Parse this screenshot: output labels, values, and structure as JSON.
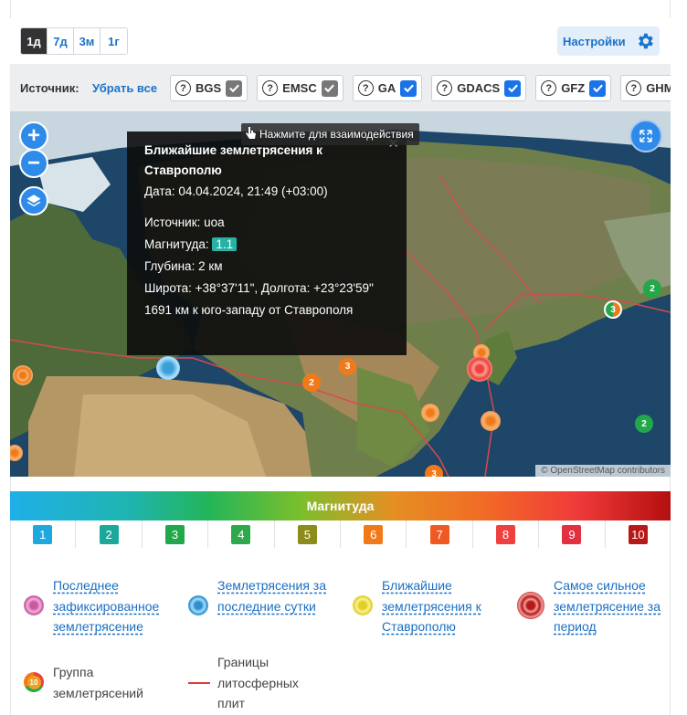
{
  "periods": [
    "1д",
    "7д",
    "3м",
    "1г"
  ],
  "settings_label": "Настройки",
  "source": {
    "label": "Источник:",
    "clear_all": "Убрать все",
    "chips": [
      {
        "name": "BGS",
        "checked": true,
        "color": "grey"
      },
      {
        "name": "EMSC",
        "checked": true,
        "color": "grey"
      },
      {
        "name": "GA",
        "checked": true,
        "color": "blue"
      },
      {
        "name": "GDACS",
        "checked": true,
        "color": "blue"
      },
      {
        "name": "GFZ",
        "checked": true,
        "color": "blue"
      },
      {
        "name": "GHM",
        "checked": false,
        "color": "grey"
      }
    ]
  },
  "map": {
    "hint": "Нажмите для взаимодействия",
    "attribution": "© OpenStreetMap contributors",
    "popup": {
      "title": "Ближайшие землетрясения к Ставрополю",
      "date": "Дата: 04.04.2024, 21:49 (+03:00)",
      "source": "Источник: uoa",
      "mag_label": "Магнитуда:",
      "mag_value": "1.1",
      "depth": "Глубина: 2 км",
      "coords": "Широта: +38°37'11\", Долгота: +23°23'59\"",
      "distance": "1691 км к юго-западу от Ставрополя"
    },
    "markers": [
      {
        "label": "2"
      },
      {
        "label": "3"
      },
      {
        "label": "3"
      },
      {
        "label": "2"
      },
      {
        "label": "2"
      },
      {
        "label": "3"
      }
    ]
  },
  "scale": {
    "title": "Магнитуда",
    "values": [
      "1",
      "2",
      "3",
      "4",
      "5",
      "6",
      "7",
      "8",
      "9",
      "10"
    ],
    "colors": [
      "#1ea8e0",
      "#1aa89a",
      "#22a84a",
      "#2ea84a",
      "#8c8c1a",
      "#f07a1a",
      "#f05a22",
      "#ef4040",
      "#e23040",
      "#b81818"
    ]
  },
  "legend": {
    "last": "Последнее зафиксированное землетрясение",
    "day": "Землетрясения за последние сутки",
    "nearest": "Ближайшие землетрясения к Ставрополю",
    "strongest": "Самое сильное землетрясение за период",
    "group": "Группа землетрясений",
    "group_badge": "10",
    "plates": "Границы литосферных плит"
  }
}
